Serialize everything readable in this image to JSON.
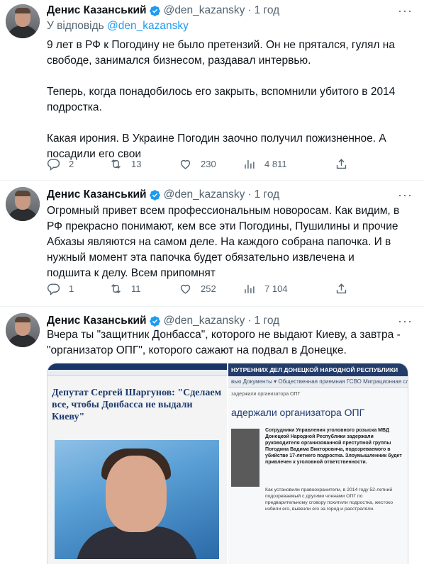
{
  "author": {
    "name": "Денис Казанський",
    "handle": "@den_kazansky"
  },
  "tweets": [
    {
      "time": "1 год",
      "reply_prefix": "У відповідь",
      "reply_handle": "@den_kazansky",
      "text": "9 лет в РФ к Погодину не было претензий. Он не прятался, гулял на свободе, занимался бизнесом, раздавал интервью.\n\nТеперь, когда понадобилось его закрыть, вспомнили убитого в 2014 подростка.\n\nКакая ирония. В Украине Погодин заочно получил пожизненное. А посадили его свои",
      "replies": "2",
      "retweets": "13",
      "likes": "230",
      "views": "4 811"
    },
    {
      "time": "1 год",
      "text": "Огромный привет всем профессиональным новоросам. Как видим, в РФ прекрасно понимают, кем все эти Погодины, Пушилины и прочие Абхазы являются на самом деле. На каждого собрана папочка. И в нужный момент эта папочка будет обязательно извлечена и подшита к делу. Всем припомнят",
      "replies": "1",
      "retweets": "11",
      "likes": "252",
      "views": "7 104"
    },
    {
      "time": "1 год",
      "text": "Вчера ты \"защитник Донбасса\", которого не выдают Киеву, а завтра - \"организатор ОПГ\", которого сажают на подвал в Донецке."
    }
  ],
  "media": {
    "left_headline": "Депутат Сергей Шаргунов: \"Сделаем все, чтобы Донбасса не выдали Киеву\"",
    "right_header": "НУТРЕННИХ ДЕЛ ДОНЕЦКОЙ НАРОДНОЙ РЕСПУБЛИКИ",
    "right_menu": "вью   Документы ▾   Общественная приемная   ГСВО   Миграционная служба",
    "right_crumb": "задержали организатора ОПГ",
    "right_title": "адержали организатора ОПГ",
    "right_bold": "Сотрудники Управления уголовного розыска МВД Донецкой Народной Республики задержали руководителя организованной преступной группы Погодина Вадима Викторовича, подозреваемого в убийстве 17-летнего подростка. Злоумышленник будет привлечен к уголовной ответственности.",
    "right_body": "Как установили правоохранители, в 2014 году 52-летний подозреваемый с другими членами ОПГ по предварительному сговору похитили подростка, жестоко избили его, вывезли его за город и расстреляли."
  },
  "colors": {
    "accent": "#1d9bf0",
    "secondary_text": "#536471",
    "divider": "#eff3f4"
  },
  "icons": [
    "verified-badge-icon",
    "more-icon",
    "reply-icon",
    "retweet-icon",
    "like-icon",
    "views-icon",
    "share-icon"
  ]
}
